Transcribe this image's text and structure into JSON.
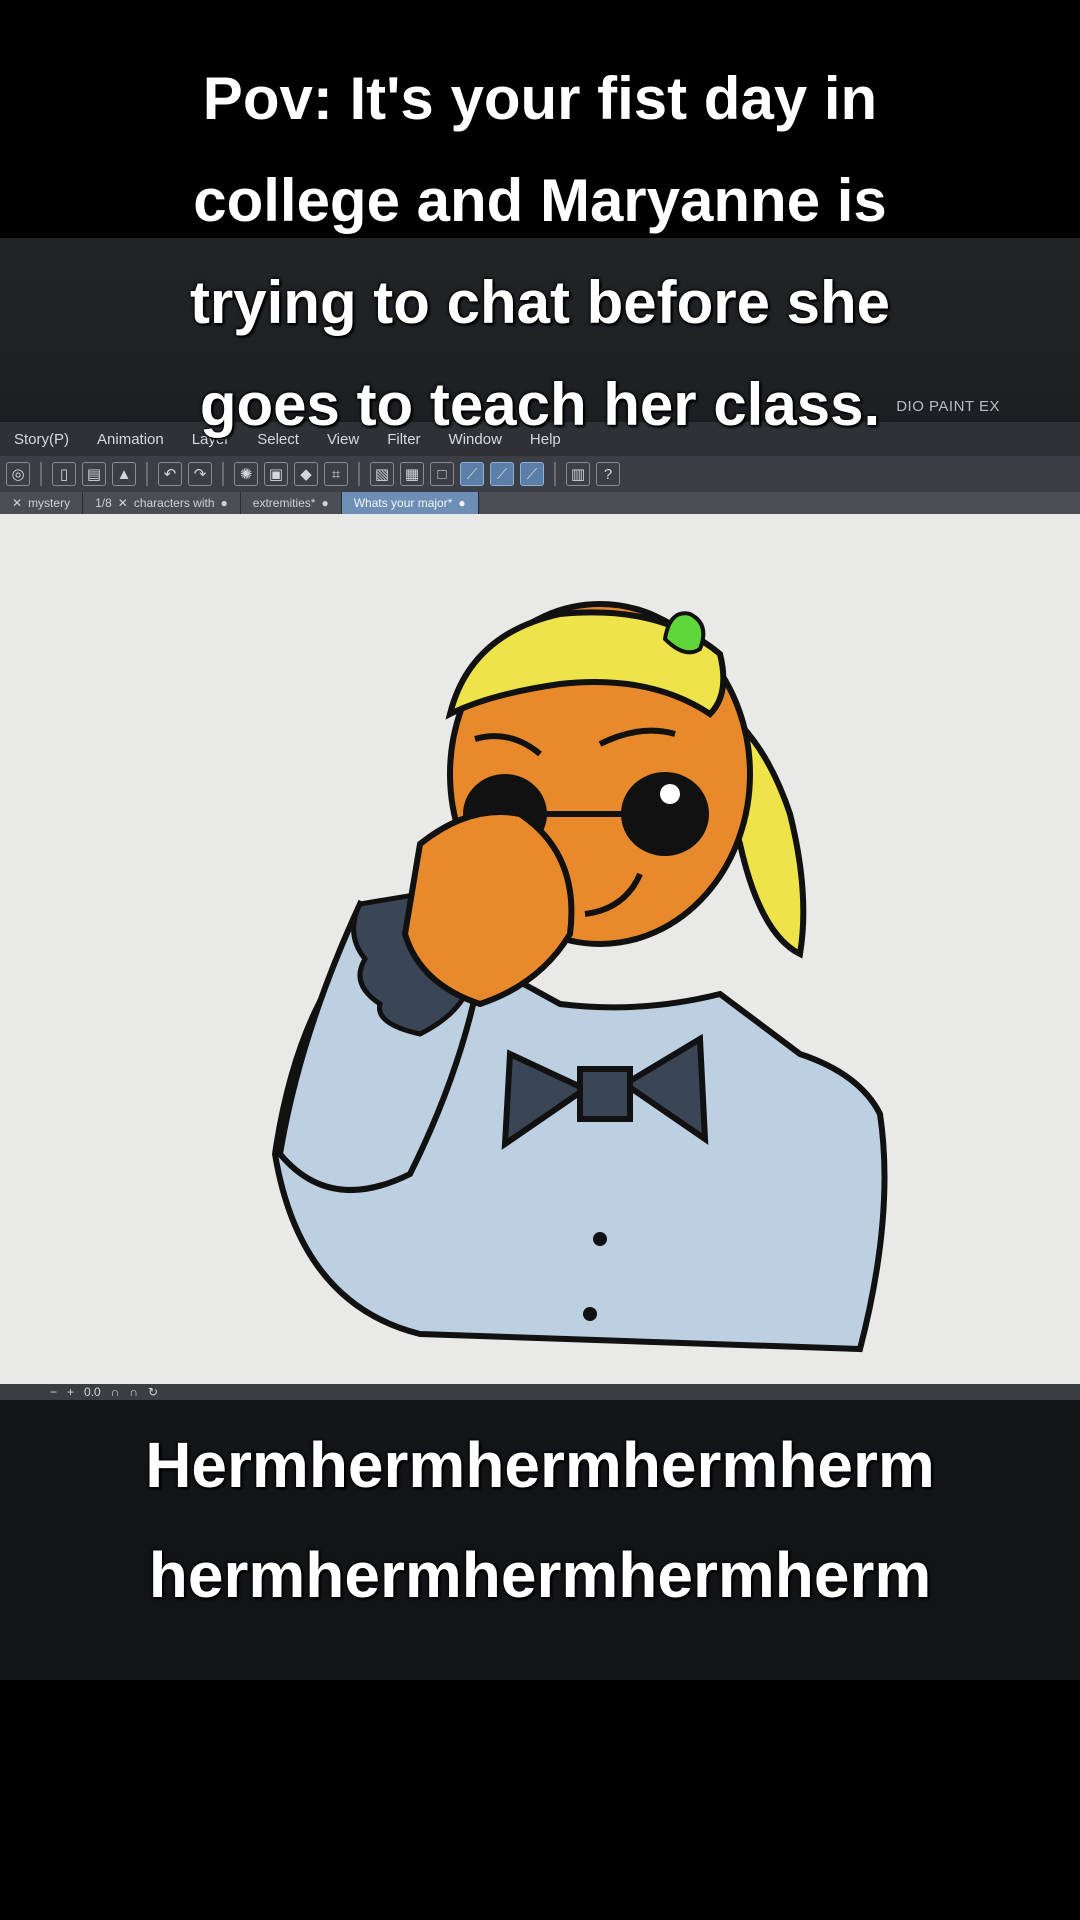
{
  "caption_top": [
    "Pov: It's your fist day in",
    "college and Maryanne is",
    "trying to chat before she",
    "goes to teach her class."
  ],
  "caption_bottom": [
    "Hermhermhermhermherm",
    "hermhermhermhermherm"
  ],
  "app": {
    "title": "DIO PAINT EX",
    "menu": [
      "Story(P)",
      "Animation",
      "Layer",
      "Select",
      "View",
      "Filter",
      "Window",
      "Help"
    ],
    "tabs": [
      "mystery",
      "1/8",
      "characters with",
      "extremities*",
      "Whats your major*"
    ],
    "status": "0.0"
  },
  "colors": {
    "skin": "#e8892c",
    "hair": "#eee44a",
    "shirt": "#bcd0e2",
    "bow": "#3a4655",
    "leaf": "#5fd73a"
  }
}
